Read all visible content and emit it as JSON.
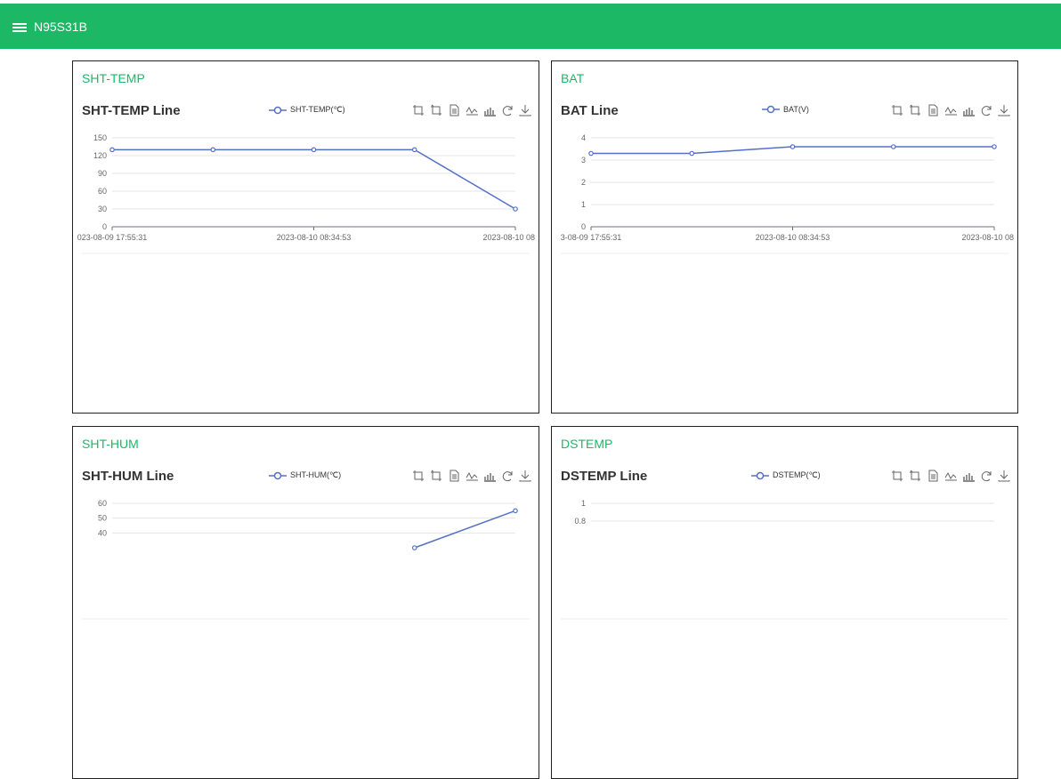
{
  "header": {
    "title": "N95S31B",
    "background_color": "#1db866"
  },
  "toolbox_icons": [
    "zoom-icon",
    "zoom-reset-icon",
    "data-view-icon",
    "line-chart-icon",
    "bar-chart-icon",
    "restore-icon",
    "download-icon"
  ],
  "cards": [
    {
      "label": "SHT-TEMP",
      "chart_title": "SHT-TEMP Line",
      "legend": "SHT-TEMP(℃)"
    },
    {
      "label": "BAT",
      "chart_title": "BAT Line",
      "legend": "BAT(V)"
    },
    {
      "label": "SHT-HUM",
      "chart_title": "SHT-HUM Line",
      "legend": "SHT-HUM(℃)"
    },
    {
      "label": "DSTEMP",
      "chart_title": "DSTEMP Line",
      "legend": "DSTEMP(℃)"
    }
  ],
  "chart_data": [
    {
      "type": "line",
      "title": "SHT-TEMP Line",
      "series": [
        {
          "name": "SHT-TEMP(℃)",
          "values": [
            130,
            130,
            130,
            130,
            30
          ]
        }
      ],
      "x_tick_labels": [
        "023-08-09 17:55:31",
        "2023-08-10 08:34:53",
        "2023-08-10 08"
      ],
      "y_ticks": [
        "0",
        "30",
        "60",
        "90",
        "120",
        "150"
      ],
      "ylim": [
        0,
        150
      ],
      "color": "#5470c6"
    },
    {
      "type": "line",
      "title": "BAT Line",
      "series": [
        {
          "name": "BAT(V)",
          "values": [
            3.3,
            3.3,
            3.6,
            3.6,
            3.6
          ]
        }
      ],
      "x_tick_labels": [
        "3-08-09 17:55:31",
        "2023-08-10 08:34:53",
        "2023-08-10 08"
      ],
      "y_ticks": [
        "0",
        "1",
        "2",
        "3",
        "4"
      ],
      "ylim": [
        0,
        4
      ],
      "color": "#5470c6"
    },
    {
      "type": "line",
      "title": "SHT-HUM Line",
      "series": [
        {
          "name": "SHT-HUM(℃)",
          "values": [
            null,
            null,
            null,
            30,
            55
          ]
        }
      ],
      "x_tick_labels": [],
      "y_ticks": [
        "40",
        "50",
        "60"
      ],
      "ylim": [
        0,
        60
      ],
      "color": "#5470c6"
    },
    {
      "type": "line",
      "title": "DSTEMP Line",
      "series": [
        {
          "name": "DSTEMP(℃)",
          "values": []
        }
      ],
      "x_tick_labels": [],
      "y_ticks": [
        "0.8",
        "1"
      ],
      "ylim": [
        0,
        1
      ],
      "color": "#5470c6"
    }
  ]
}
